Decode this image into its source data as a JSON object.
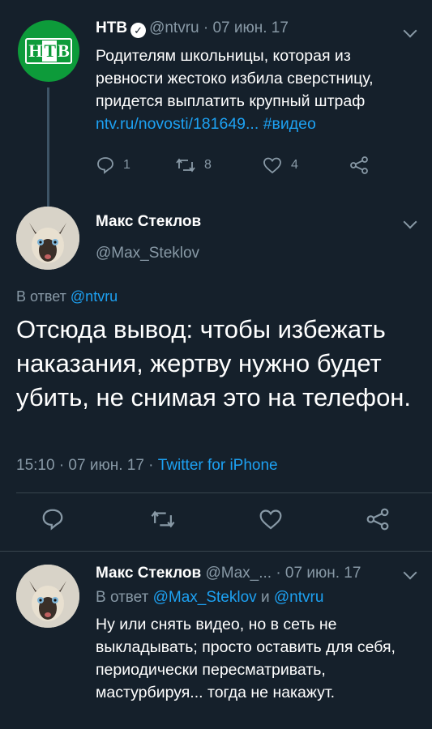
{
  "tweet1": {
    "name": "НТВ",
    "handle": "@ntvru",
    "date": "· 07 июн. 17",
    "text": "Родителям школьницы, которая из ревности жестоко избила сверстницу, придется выплатить крупный штраф",
    "link": "ntv.ru/novosti/181649...",
    "hashtag": "#видео",
    "reply_count": "1",
    "retweet_count": "8",
    "like_count": "4",
    "logo_text_left": "Н",
    "logo_text_mid": "Т",
    "logo_text_right": "В"
  },
  "tweet2": {
    "name": "Макс Стеклов",
    "handle": "@Max_Steklov",
    "reply_prefix": "В ответ",
    "reply_to": "@ntvru",
    "text": "Отсюда вывод: чтобы избежать наказания, жертву нужно будет убить, не снимая это на телефон.",
    "time_date": "15:10 · 07 июн. 17 ·",
    "client": "Twitter for iPhone"
  },
  "tweet3": {
    "name": "Макс Стеклов",
    "handle": "@Max_...",
    "date": "· 07 июн. 17",
    "reply_prefix": "В ответ",
    "reply_to_1": "@Max_Steklov",
    "reply_and": "и",
    "reply_to_2": "@ntvru",
    "text": "Ну или снять видео, но в сеть не выкладывать; просто оставить для себя, периодически пересматривать, мастурбируя... тогда не накажут."
  },
  "colors": {
    "background": "#15202b",
    "accent": "#1da1f2",
    "secondary_text": "#8899a6",
    "ntv_green": "#0d9b3a"
  },
  "icons": [
    "reply-icon",
    "retweet-icon",
    "like-icon",
    "share-icon",
    "verified-icon",
    "chevron-down-icon"
  ]
}
